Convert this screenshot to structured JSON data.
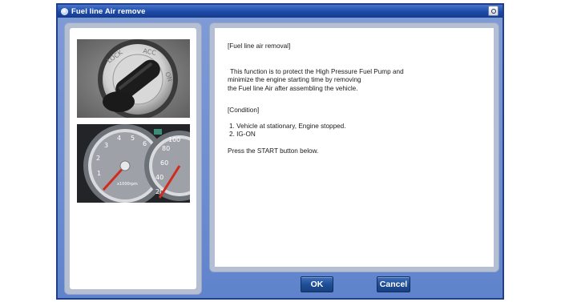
{
  "window": {
    "title": "Fuel line Air remove"
  },
  "left_images": [
    {
      "icon": "ignition-key-photo"
    },
    {
      "icon": "instrument-cluster-photo"
    }
  ],
  "message": {
    "heading": "[Fuel line air removal]",
    "description": [
      "This function is to protect the High Pressure Fuel Pump and",
      "minimize the engine starting time by removing",
      "the Fuel line Air after assembling the vehicle."
    ],
    "condition_heading": "[Condition]",
    "conditions": [
      "1. Vehicle at stationary, Engine stopped.",
      "2. IG-ON"
    ],
    "instruction": "Press the START button below."
  },
  "buttons": {
    "ok": "OK",
    "cancel": "Cancel"
  },
  "colors": {
    "titlebar": "#1d4aa8",
    "frame": "#5f83cc",
    "button": "#1f4f98"
  }
}
